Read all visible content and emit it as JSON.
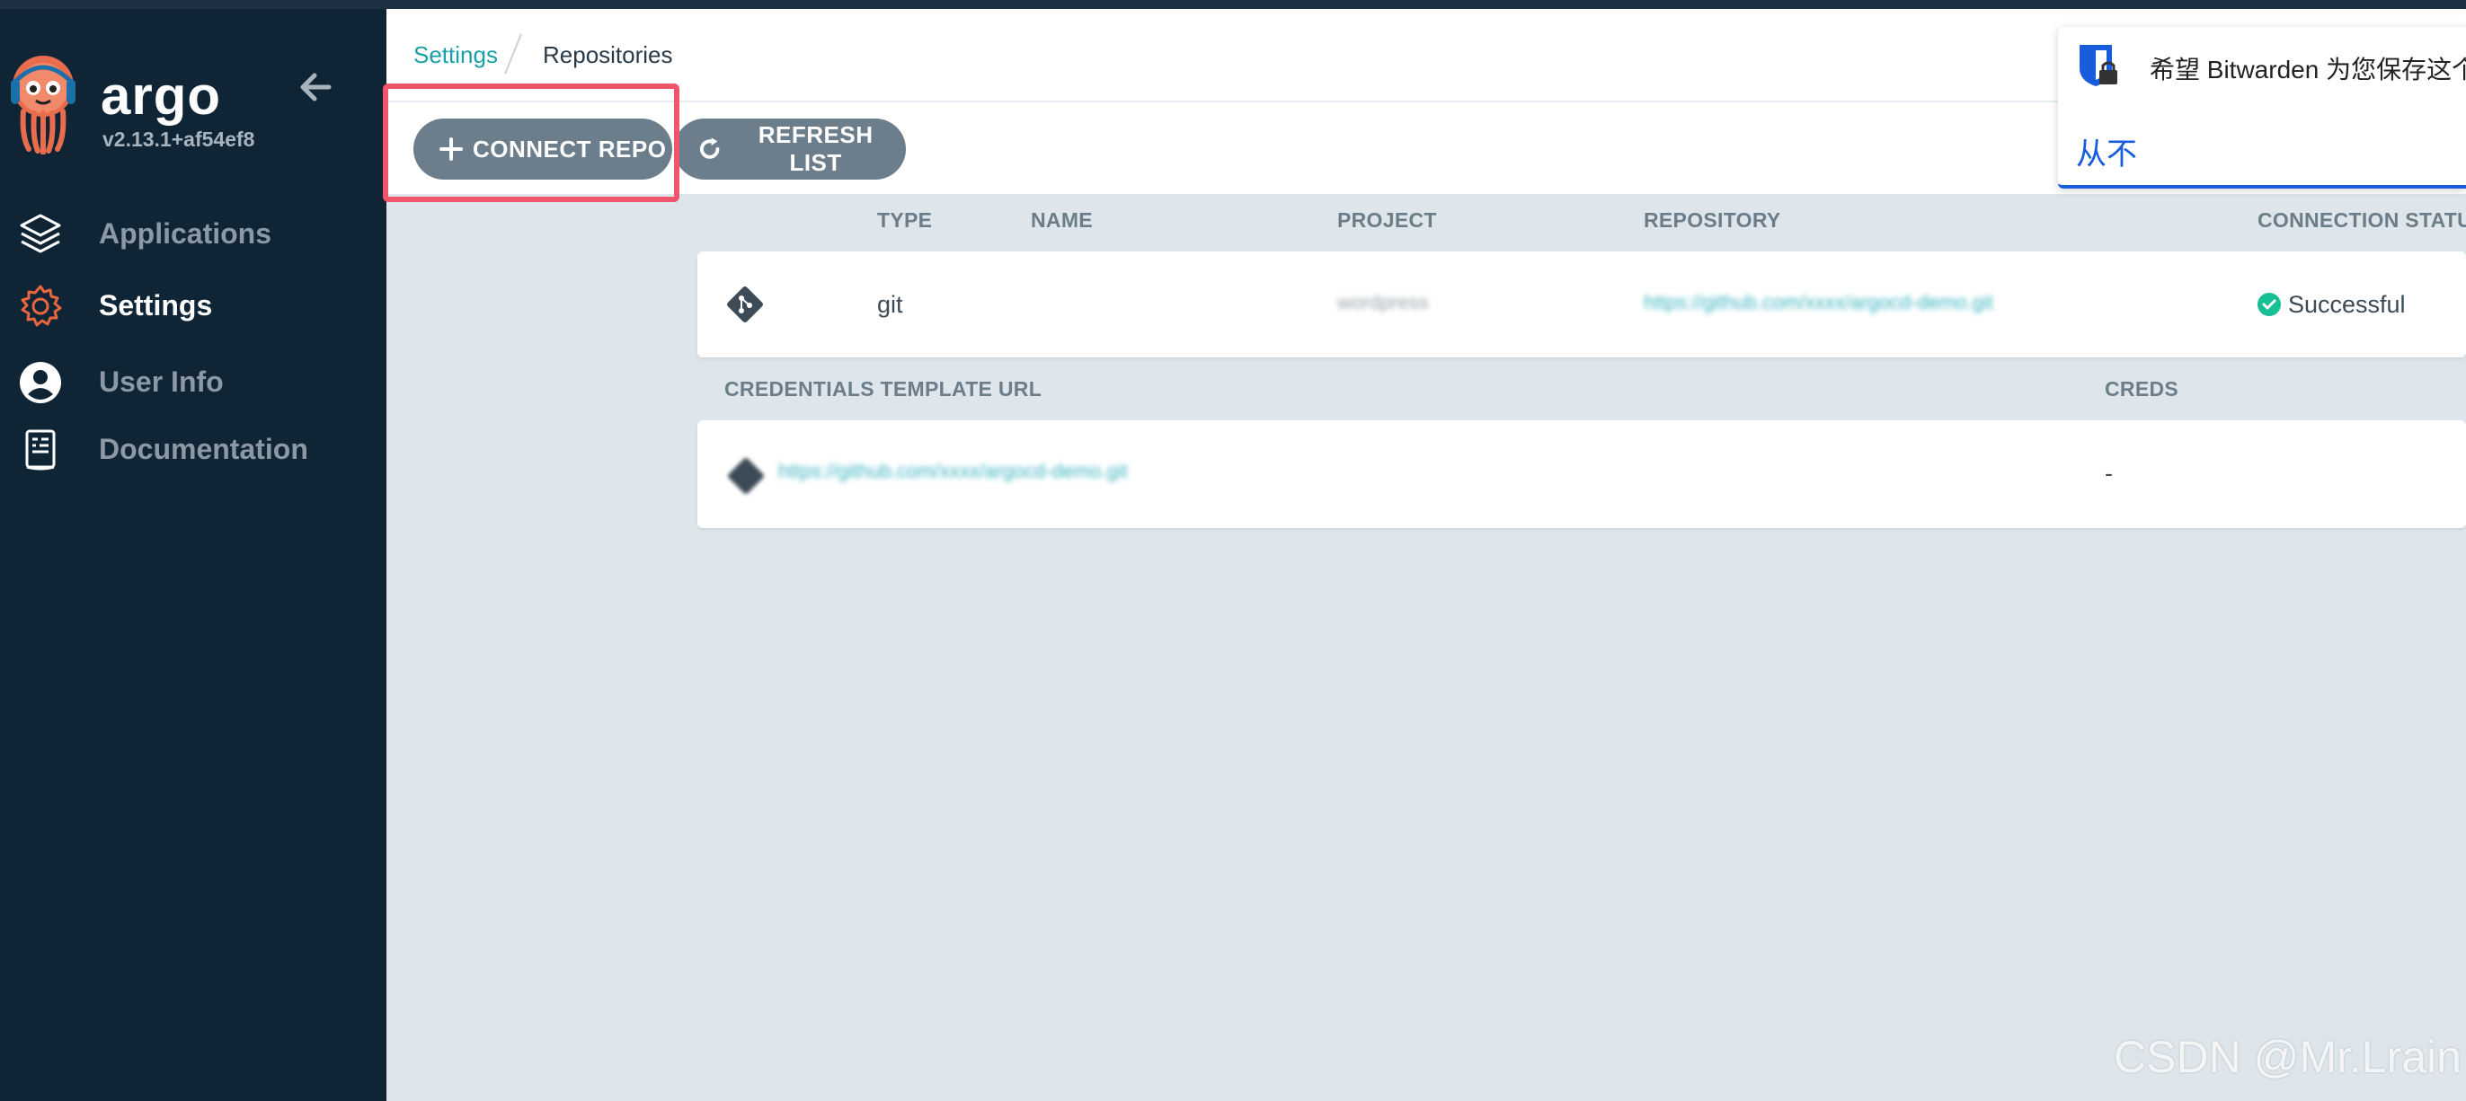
{
  "app": {
    "brand": "argo",
    "version": "v2.13.1+af54ef8"
  },
  "sidebar": {
    "items": [
      {
        "label": "Applications",
        "icon": "layers-icon",
        "active": false
      },
      {
        "label": "Settings",
        "icon": "gear-icon",
        "active": true
      },
      {
        "label": "User Info",
        "icon": "user-circle-icon",
        "active": false
      },
      {
        "label": "Documentation",
        "icon": "book-icon",
        "active": false
      }
    ]
  },
  "breadcrumb": {
    "parent": "Settings",
    "current": "Repositories"
  },
  "toolbar": {
    "connect_label": "CONNECT REPO",
    "refresh_label": "REFRESH LIST"
  },
  "repositories": {
    "columns": [
      "TYPE",
      "NAME",
      "PROJECT",
      "REPOSITORY",
      "CONNECTION STATUS"
    ],
    "rows": [
      {
        "type": "git",
        "name": "",
        "project": "wordpress",
        "repository": "https://github.com/xxxx/argocd-demo.git",
        "status": "Successful"
      }
    ]
  },
  "credentials": {
    "columns": [
      "CREDENTIALS TEMPLATE URL",
      "CREDS"
    ],
    "rows": [
      {
        "url": "https://github.com/xxxx/argocd-demo.git",
        "creds": "-"
      }
    ]
  },
  "bitwarden": {
    "message": "希望 Bitwarden 为您保存这个",
    "never_label": "从不"
  },
  "watermark": "CSDN @Mr.Lrain",
  "colors": {
    "sidebar_bg": "#0f2536",
    "accent_teal": "#1a9fa8",
    "button_bg": "#6c7e8c",
    "highlight": "#f0556a",
    "success": "#18be94",
    "bitwarden_blue": "#175ddc",
    "settings_icon": "#e9663f"
  }
}
